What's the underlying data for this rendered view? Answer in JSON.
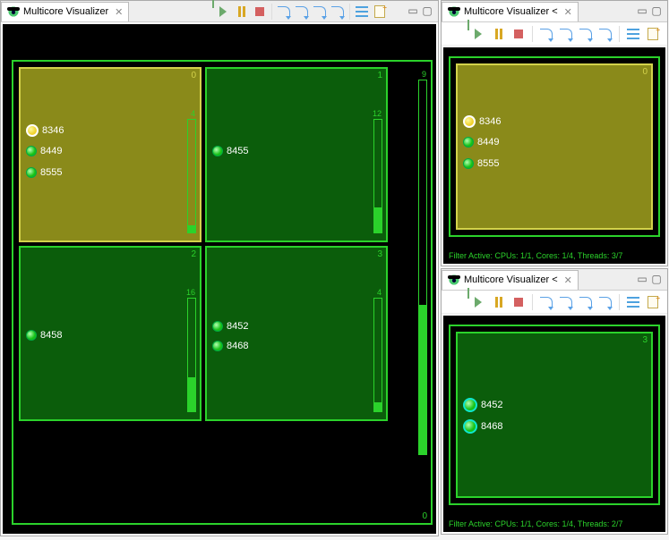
{
  "main": {
    "tab_title": "Multicore Visualizer",
    "cpu_outer_id": "0",
    "side_meter": {
      "label": "9",
      "fill_pct": 40
    },
    "cores": [
      {
        "id": "0",
        "selected": true,
        "meter": {
          "label": "4",
          "fill_pct": 6
        },
        "threads": [
          {
            "id": "8346",
            "selected": true
          },
          {
            "id": "8449"
          },
          {
            "id": "8555"
          }
        ]
      },
      {
        "id": "1",
        "meter": {
          "label": "12",
          "fill_pct": 22
        },
        "threads": [
          {
            "id": "8455"
          }
        ]
      },
      {
        "id": "2",
        "meter": {
          "label": "16",
          "fill_pct": 30
        },
        "threads": [
          {
            "id": "8458"
          }
        ]
      },
      {
        "id": "3",
        "meter": {
          "label": "4",
          "fill_pct": 8
        },
        "threads": [
          {
            "id": "8452"
          },
          {
            "id": "8468"
          }
        ]
      }
    ]
  },
  "right_top": {
    "tab_title": "Multicore Visualizer <",
    "filter_text": "Filter Active:   CPUs: 1/1, Cores: 1/4, Threads: 3/7",
    "core_id": "0",
    "threads": [
      {
        "id": "8346",
        "selected": true
      },
      {
        "id": "8449"
      },
      {
        "id": "8555"
      }
    ]
  },
  "right_bot": {
    "tab_title": "Multicore Visualizer <",
    "filter_text": "Filter Active:   CPUs: 1/1, Cores: 1/4, Threads: 2/7",
    "core_id": "3",
    "threads": [
      {
        "id": "8452",
        "big": true
      },
      {
        "id": "8468",
        "big": true
      }
    ]
  },
  "icons": {
    "close_x": "✕",
    "min": "▭",
    "max": "▢"
  }
}
